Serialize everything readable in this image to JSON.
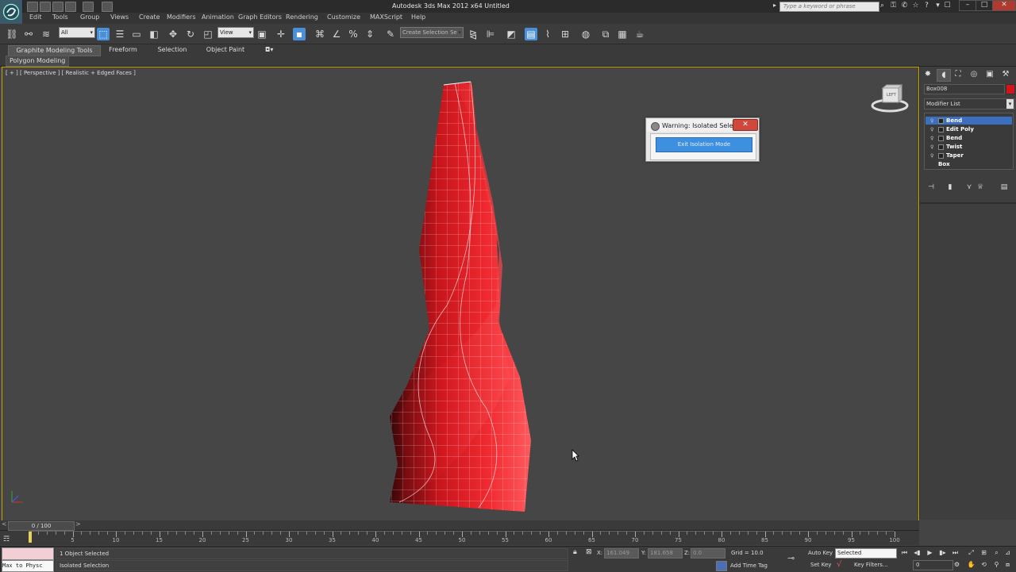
{
  "window": {
    "title": "Autodesk 3ds Max  2012 x64      Untitled",
    "search_placeholder": "Type a keyword or phrase",
    "controls": [
      "–",
      "□",
      "✕"
    ]
  },
  "menu": [
    "Edit",
    "Tools",
    "Group",
    "Views",
    "Create",
    "Modifiers",
    "Animation",
    "Graph Editors",
    "Rendering",
    "Customize",
    "MAXScript",
    "Help"
  ],
  "toolbar": {
    "selection_filter": "All",
    "reference_coord": "View",
    "named_selection": "Create Selection Se"
  },
  "ribbon": {
    "tabs": [
      "Graphite Modeling Tools",
      "Freeform",
      "Selection",
      "Object Paint"
    ],
    "active_tab": "Graphite Modeling Tools",
    "subpanel": "Polygon Modeling"
  },
  "viewport": {
    "label": "[ + ] [ Perspective ] [ Realistic + Edged Faces ]",
    "viewcube_face": "LEFT"
  },
  "dialog": {
    "title": "Warning: Isolated Sele...",
    "button": "Exit Isolation Mode"
  },
  "command_panel": {
    "object_name": "Box008",
    "object_color": "#d4141a",
    "modifier_list_label": "Modifier List",
    "stack": [
      {
        "label": "Bend",
        "selected": true
      },
      {
        "label": "Edit Poly",
        "selected": false
      },
      {
        "label": "Bend",
        "selected": false
      },
      {
        "label": "Twist",
        "selected": false
      },
      {
        "label": "Taper",
        "selected": false
      },
      {
        "label": "Box",
        "selected": false
      }
    ]
  },
  "timeline": {
    "frame_display": "0 / 100",
    "ticks": [
      "5",
      "10",
      "15",
      "20",
      "25",
      "30",
      "35",
      "40",
      "45",
      "50",
      "55",
      "60",
      "65",
      "70",
      "75",
      "80",
      "85",
      "90",
      "95",
      "100"
    ]
  },
  "status": {
    "maxscript_text": "Max to Physc",
    "line1": "1 Object Selected",
    "line2": "Isolated Selection",
    "x_label": "X:",
    "x_value": "161.049",
    "y_label": "Y:",
    "y_value": "181.658",
    "z_label": "Z:",
    "z_value": "0.0",
    "grid": "Grid = 10.0",
    "add_time_tag": "Add Time Tag",
    "auto_key": "Auto Key",
    "set_key": "Set Key",
    "key_mode": "Selected",
    "key_filters": "Key Filters...",
    "current_frame": "0"
  },
  "colors": {
    "accent": "#4a90d9",
    "viewport_border": "#c8a200",
    "object": "#e8262c"
  }
}
